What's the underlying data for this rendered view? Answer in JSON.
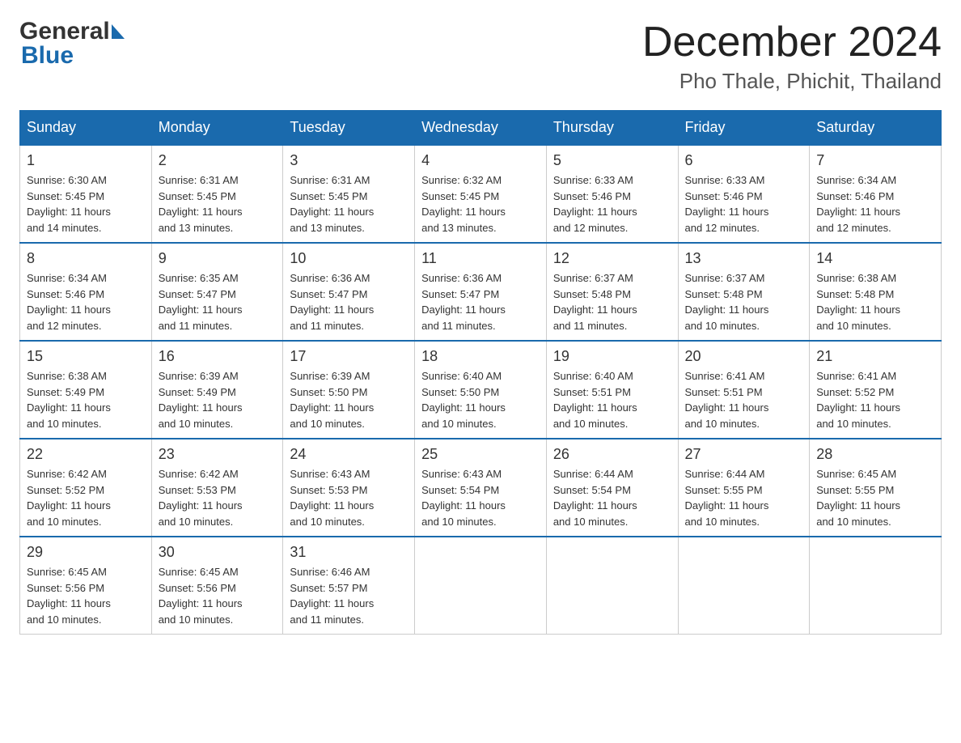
{
  "header": {
    "logo_general": "General",
    "logo_blue": "Blue",
    "month_title": "December 2024",
    "location": "Pho Thale, Phichit, Thailand"
  },
  "days_of_week": [
    "Sunday",
    "Monday",
    "Tuesday",
    "Wednesday",
    "Thursday",
    "Friday",
    "Saturday"
  ],
  "weeks": [
    [
      {
        "day": "1",
        "sunrise": "6:30 AM",
        "sunset": "5:45 PM",
        "daylight": "11 hours and 14 minutes."
      },
      {
        "day": "2",
        "sunrise": "6:31 AM",
        "sunset": "5:45 PM",
        "daylight": "11 hours and 13 minutes."
      },
      {
        "day": "3",
        "sunrise": "6:31 AM",
        "sunset": "5:45 PM",
        "daylight": "11 hours and 13 minutes."
      },
      {
        "day": "4",
        "sunrise": "6:32 AM",
        "sunset": "5:45 PM",
        "daylight": "11 hours and 13 minutes."
      },
      {
        "day": "5",
        "sunrise": "6:33 AM",
        "sunset": "5:46 PM",
        "daylight": "11 hours and 12 minutes."
      },
      {
        "day": "6",
        "sunrise": "6:33 AM",
        "sunset": "5:46 PM",
        "daylight": "11 hours and 12 minutes."
      },
      {
        "day": "7",
        "sunrise": "6:34 AM",
        "sunset": "5:46 PM",
        "daylight": "11 hours and 12 minutes."
      }
    ],
    [
      {
        "day": "8",
        "sunrise": "6:34 AM",
        "sunset": "5:46 PM",
        "daylight": "11 hours and 12 minutes."
      },
      {
        "day": "9",
        "sunrise": "6:35 AM",
        "sunset": "5:47 PM",
        "daylight": "11 hours and 11 minutes."
      },
      {
        "day": "10",
        "sunrise": "6:36 AM",
        "sunset": "5:47 PM",
        "daylight": "11 hours and 11 minutes."
      },
      {
        "day": "11",
        "sunrise": "6:36 AM",
        "sunset": "5:47 PM",
        "daylight": "11 hours and 11 minutes."
      },
      {
        "day": "12",
        "sunrise": "6:37 AM",
        "sunset": "5:48 PM",
        "daylight": "11 hours and 11 minutes."
      },
      {
        "day": "13",
        "sunrise": "6:37 AM",
        "sunset": "5:48 PM",
        "daylight": "11 hours and 10 minutes."
      },
      {
        "day": "14",
        "sunrise": "6:38 AM",
        "sunset": "5:48 PM",
        "daylight": "11 hours and 10 minutes."
      }
    ],
    [
      {
        "day": "15",
        "sunrise": "6:38 AM",
        "sunset": "5:49 PM",
        "daylight": "11 hours and 10 minutes."
      },
      {
        "day": "16",
        "sunrise": "6:39 AM",
        "sunset": "5:49 PM",
        "daylight": "11 hours and 10 minutes."
      },
      {
        "day": "17",
        "sunrise": "6:39 AM",
        "sunset": "5:50 PM",
        "daylight": "11 hours and 10 minutes."
      },
      {
        "day": "18",
        "sunrise": "6:40 AM",
        "sunset": "5:50 PM",
        "daylight": "11 hours and 10 minutes."
      },
      {
        "day": "19",
        "sunrise": "6:40 AM",
        "sunset": "5:51 PM",
        "daylight": "11 hours and 10 minutes."
      },
      {
        "day": "20",
        "sunrise": "6:41 AM",
        "sunset": "5:51 PM",
        "daylight": "11 hours and 10 minutes."
      },
      {
        "day": "21",
        "sunrise": "6:41 AM",
        "sunset": "5:52 PM",
        "daylight": "11 hours and 10 minutes."
      }
    ],
    [
      {
        "day": "22",
        "sunrise": "6:42 AM",
        "sunset": "5:52 PM",
        "daylight": "11 hours and 10 minutes."
      },
      {
        "day": "23",
        "sunrise": "6:42 AM",
        "sunset": "5:53 PM",
        "daylight": "11 hours and 10 minutes."
      },
      {
        "day": "24",
        "sunrise": "6:43 AM",
        "sunset": "5:53 PM",
        "daylight": "11 hours and 10 minutes."
      },
      {
        "day": "25",
        "sunrise": "6:43 AM",
        "sunset": "5:54 PM",
        "daylight": "11 hours and 10 minutes."
      },
      {
        "day": "26",
        "sunrise": "6:44 AM",
        "sunset": "5:54 PM",
        "daylight": "11 hours and 10 minutes."
      },
      {
        "day": "27",
        "sunrise": "6:44 AM",
        "sunset": "5:55 PM",
        "daylight": "11 hours and 10 minutes."
      },
      {
        "day": "28",
        "sunrise": "6:45 AM",
        "sunset": "5:55 PM",
        "daylight": "11 hours and 10 minutes."
      }
    ],
    [
      {
        "day": "29",
        "sunrise": "6:45 AM",
        "sunset": "5:56 PM",
        "daylight": "11 hours and 10 minutes."
      },
      {
        "day": "30",
        "sunrise": "6:45 AM",
        "sunset": "5:56 PM",
        "daylight": "11 hours and 10 minutes."
      },
      {
        "day": "31",
        "sunrise": "6:46 AM",
        "sunset": "5:57 PM",
        "daylight": "11 hours and 11 minutes."
      },
      null,
      null,
      null,
      null
    ]
  ],
  "labels": {
    "sunrise_prefix": "Sunrise: ",
    "sunset_prefix": "Sunset: ",
    "daylight_prefix": "Daylight: "
  }
}
